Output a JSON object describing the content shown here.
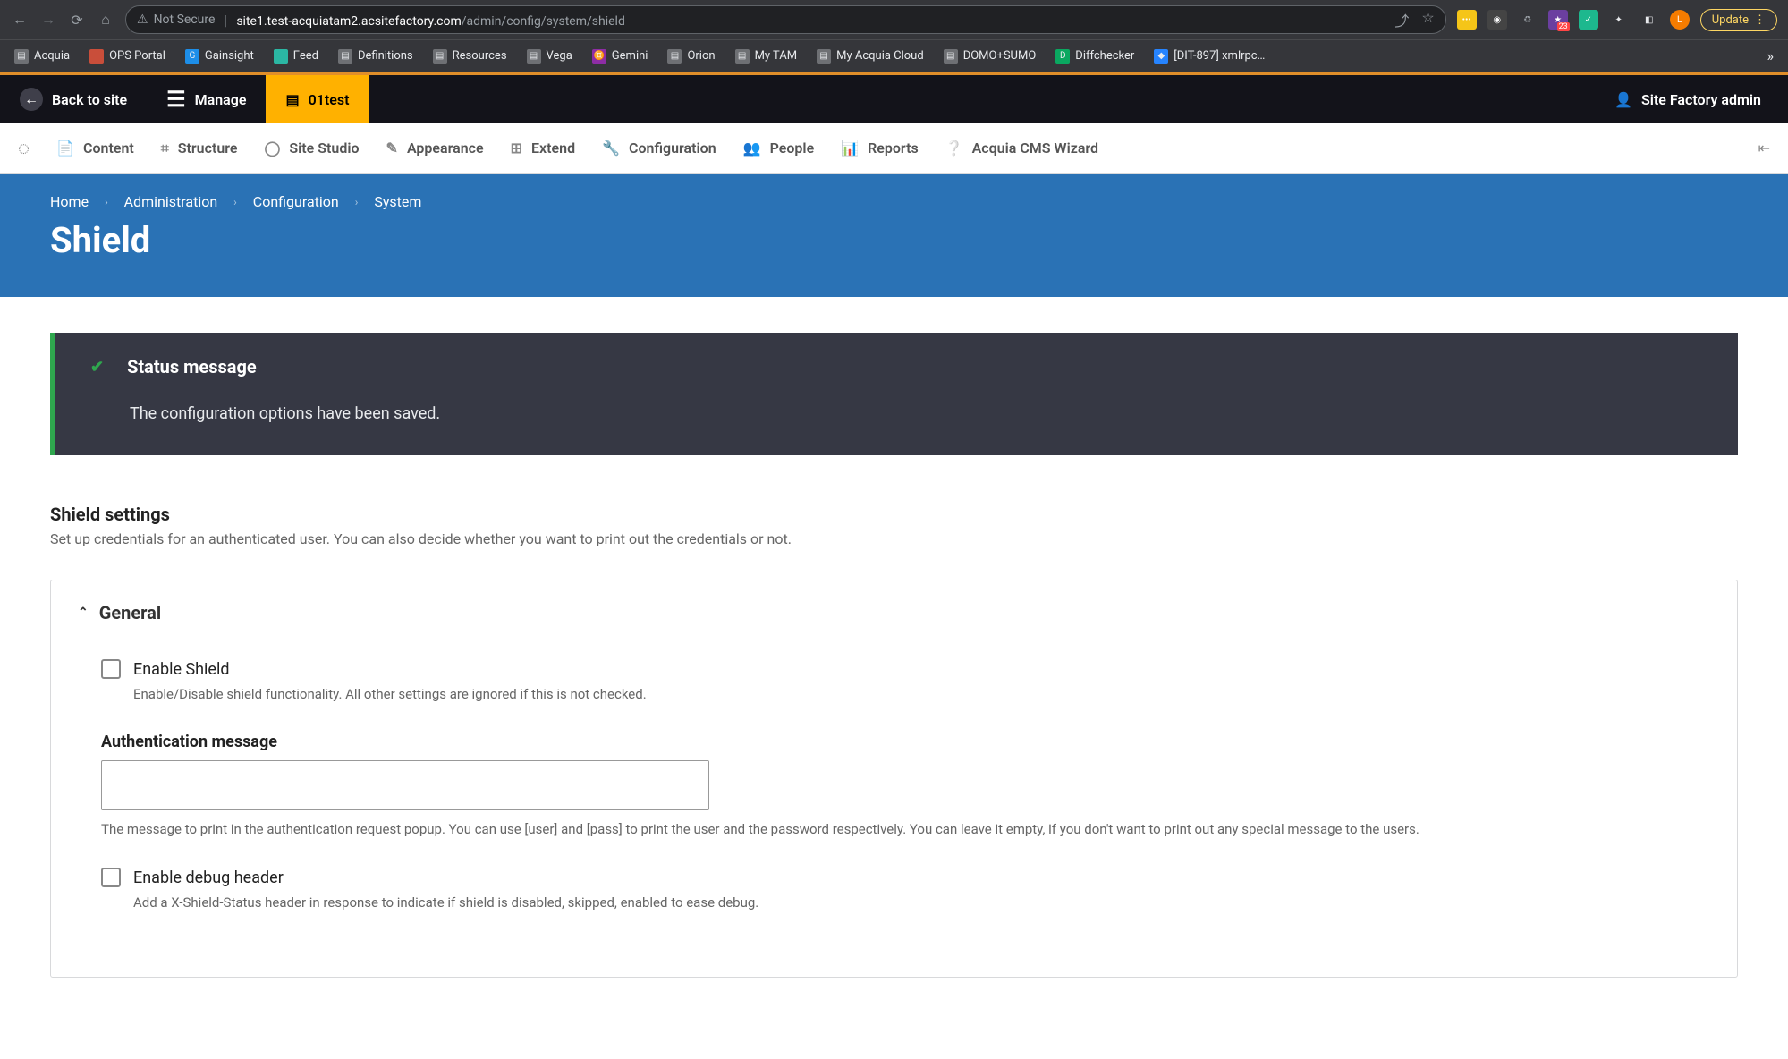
{
  "browser": {
    "not_secure": "Not Secure",
    "url_host": "site1.test-acquiatam2.acsitefactory.com",
    "url_path": "/admin/config/system/shield",
    "update": "Update",
    "ext_badge": "23",
    "profile_letter": "L"
  },
  "bookmarks": [
    {
      "label": "Acquia"
    },
    {
      "label": "OPS Portal"
    },
    {
      "label": "Gainsight"
    },
    {
      "label": "Feed"
    },
    {
      "label": "Definitions"
    },
    {
      "label": "Resources"
    },
    {
      "label": "Vega"
    },
    {
      "label": "Gemini"
    },
    {
      "label": "Orion"
    },
    {
      "label": "My TAM"
    },
    {
      "label": "My Acquia Cloud"
    },
    {
      "label": "DOMO+SUMO"
    },
    {
      "label": "Diffchecker"
    },
    {
      "label": "[DIT-897] xmlrpc…"
    }
  ],
  "toolbar": {
    "back": "Back to site",
    "manage": "Manage",
    "env": "01test",
    "user": "Site Factory admin"
  },
  "admin_menu": {
    "content": "Content",
    "structure": "Structure",
    "site_studio": "Site Studio",
    "appearance": "Appearance",
    "extend": "Extend",
    "configuration": "Configuration",
    "people": "People",
    "reports": "Reports",
    "wizard": "Acquia CMS Wizard"
  },
  "breadcrumb": {
    "home": "Home",
    "admin": "Administration",
    "config": "Configuration",
    "system": "System"
  },
  "page_title": "Shield",
  "status": {
    "heading": "Status message",
    "body": "The configuration options have been saved."
  },
  "settings": {
    "title": "Shield settings",
    "desc": "Set up credentials for an authenticated user. You can also decide whether you want to print out the credentials or not."
  },
  "general": {
    "legend": "General",
    "enable_label": "Enable Shield",
    "enable_desc": "Enable/Disable shield functionality. All other settings are ignored if this is not checked.",
    "auth_label": "Authentication message",
    "auth_value": "",
    "auth_desc": "The message to print in the authentication request popup. You can use [user] and [pass] to print the user and the password respectively. You can leave it empty, if you don't want to print out any special message to the users.",
    "debug_label": "Enable debug header",
    "debug_desc": "Add a X-Shield-Status header in response to indicate if shield is disabled, skipped, enabled to ease debug."
  }
}
